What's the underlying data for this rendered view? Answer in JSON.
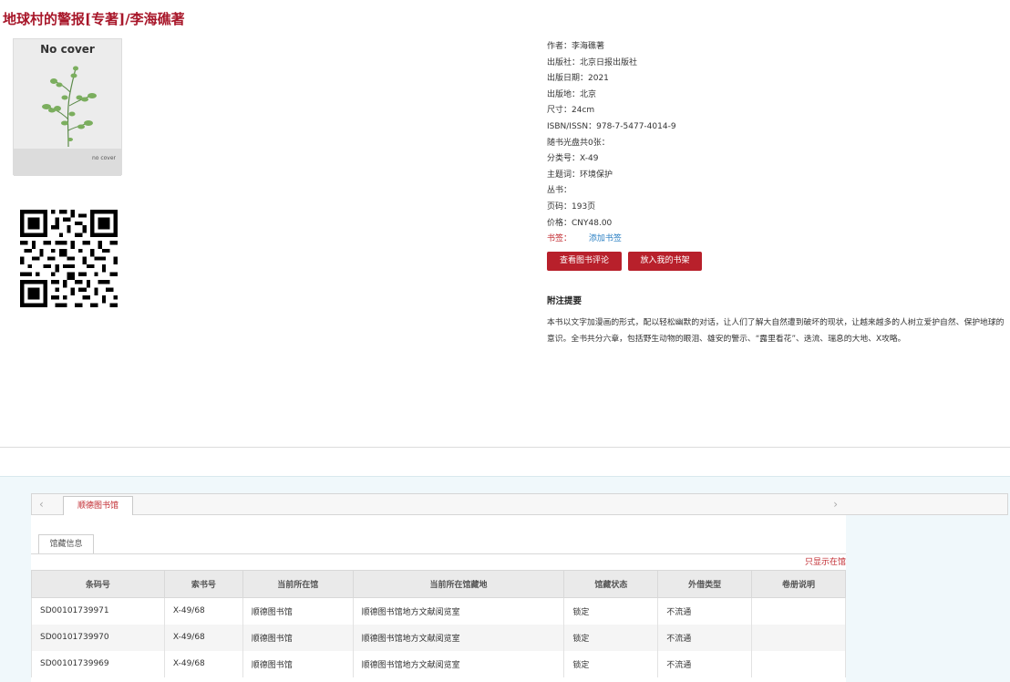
{
  "book": {
    "title": "地球村的警报[专著]/李海礁著"
  },
  "cover": {
    "label": "No cover",
    "small_label": "no cover"
  },
  "info": {
    "rows": [
      "作者：李海礁著",
      "出版社：北京日报出版社",
      "出版日期：2021",
      "出版地：北京",
      "尺寸：24cm",
      "ISBN/ISSN：978-7-5477-4014-9",
      "随书光盘共0张：",
      "分类号：X-49",
      "主题词：环境保护",
      "丛书：",
      "页码：193页",
      "价格：CNY48.00"
    ],
    "bookmark_label": "书签：",
    "bookmark_link": "添加书签"
  },
  "buttons": {
    "review": "查看图书评论",
    "shelf": "放入我的书架"
  },
  "note": {
    "heading": "附注提要",
    "body": "本书以文字加漫画的形式，配以轻松幽默的对话，让人们了解大自然遭到破坏的现状，让越来越多的人树立爱护自然、保护地球的意识。全书共分六章，包括野生动物的眼泪、雄安的警示、“露里看花”、迭流、瑞息的大地、X攻略。"
  },
  "library_tabs": {
    "active": "顺德图书馆",
    "left_arrow": "‹",
    "right_arrow": "›"
  },
  "holdings": {
    "subtab": "馆藏信息",
    "only_link": "只显示在馆",
    "columns": [
      "条码号",
      "索书号",
      "当前所在馆",
      "当前所在馆藏地",
      "馆藏状态",
      "外借类型",
      "卷册说明"
    ],
    "rows": [
      [
        "SD00101739971",
        "X-49/68",
        "顺德图书馆",
        "顺德图书馆地方文献阅览室",
        "锁定",
        "不流通",
        ""
      ],
      [
        "SD00101739970",
        "X-49/68",
        "顺德图书馆",
        "顺德图书馆地方文献阅览室",
        "锁定",
        "不流通",
        ""
      ],
      [
        "SD00101739969",
        "X-49/68",
        "顺德图书馆",
        "顺德图书馆地方文献阅览室",
        "锁定",
        "不流通",
        ""
      ]
    ]
  }
}
